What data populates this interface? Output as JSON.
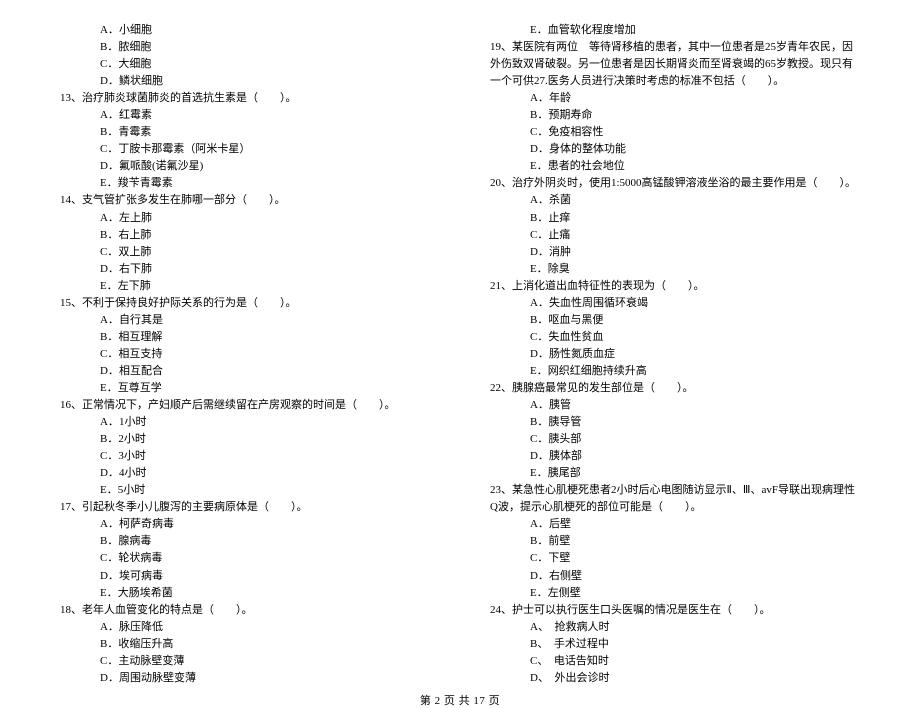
{
  "left": {
    "l1": "A．小细胞",
    "l2": "B．脓细胞",
    "l3": "C．大细胞",
    "l4": "D．鳞状细胞",
    "q13": "13、治疗肺炎球菌肺炎的首选抗生素是（　　）。",
    "l5": "A．红霉素",
    "l6": "B．青霉素",
    "l7": "C．丁胺卡那霉素（阿米卡星）",
    "l8": "D．氟哌酸(诺氟沙星)",
    "l9": "E．羧苄青霉素",
    "q14": "14、支气管扩张多发生在肺哪一部分（　　）。",
    "l10": "A．左上肺",
    "l11": "B．右上肺",
    "l12": "C．双上肺",
    "l13": "D．右下肺",
    "l14": "E．左下肺",
    "q15": "15、不利于保持良好护际关系的行为是（　　）。",
    "l15": "A．自行其是",
    "l16": "B．相互理解",
    "l17": "C．相互支持",
    "l18": "D．相互配合",
    "l19": "E．互尊互学",
    "q16": "16、正常情况下，产妇顺产后需继续留在产房观察的时间是（　　）。",
    "l20": "A．1小时",
    "l21": "B．2小时",
    "l22": "C．3小时",
    "l23": "D．4小时",
    "l24": "E．5小时",
    "q17": "17、引起秋冬季小儿腹泻的主要病原体是（　　）。",
    "l25": "A．柯萨奇病毒",
    "l26": "B．腺病毒",
    "l27": "C．轮状病毒",
    "l28": "D．埃可病毒",
    "l29": "E．大肠埃希菌",
    "q18": "18、老年人血管变化的特点是（　　）。",
    "l30": "A．脉压降低",
    "l31": "B．收缩压升高",
    "l32": "C．主动脉壁变薄",
    "l33": "D．周围动脉壁变薄"
  },
  "right": {
    "r1": "E．血管软化程度增加",
    "q19": "19、某医院有两位　等待肾移植的患者，其中一位患者是25岁青年农民，因外伤致双肾破裂。另一位患者是因长期肾炎而至肾衰竭的65岁教授。现只有一个可供27.医务人员进行决策时考虑的标准不包括（　　）。",
    "r2": "A．年龄",
    "r3": "B．预期寿命",
    "r4": "C．免疫相容性",
    "r5": "D．身体的整体功能",
    "r6": "E．患者的社会地位",
    "q20": "20、治疗外阴炎时，使用1:5000高锰酸钾溶液坐浴的最主要作用是（　　）。",
    "r7": "A．杀菌",
    "r8": "B．止痒",
    "r9": "C．止痛",
    "r10": "D．消肿",
    "r11": "E．除臭",
    "q21": "21、上消化道出血特征性的表现为（　　）。",
    "r12": "A．失血性周围循环衰竭",
    "r13": "B．呕血与黑便",
    "r14": "C．失血性贫血",
    "r15": "D．肠性氮质血症",
    "r16": "E．网织红细胞持续升高",
    "q22": "22、胰腺癌最常见的发生部位是（　　）。",
    "r17": "A．胰管",
    "r18": "B．胰导管",
    "r19": "C．胰头部",
    "r20": "D．胰体部",
    "r21": "E．胰尾部",
    "q23": "23、某急性心肌梗死患者2小时后心电图随访显示Ⅱ、Ⅲ、avF导联出现病理性Q波，提示心肌梗死的部位可能是（　　）。",
    "r22": "A．后壁",
    "r23": "B．前壁",
    "r24": "C．下壁",
    "r25": "D．右侧壁",
    "r26": "E．左侧壁",
    "q24": "24、护士可以执行医生口头医嘱的情况是医生在（　　）。",
    "r27": "A、　抢救病人时",
    "r28": "B、　手术过程中",
    "r29": "C、　电话告知时",
    "r30": "D、　外出会诊时"
  },
  "footer": "第 2 页 共 17 页"
}
